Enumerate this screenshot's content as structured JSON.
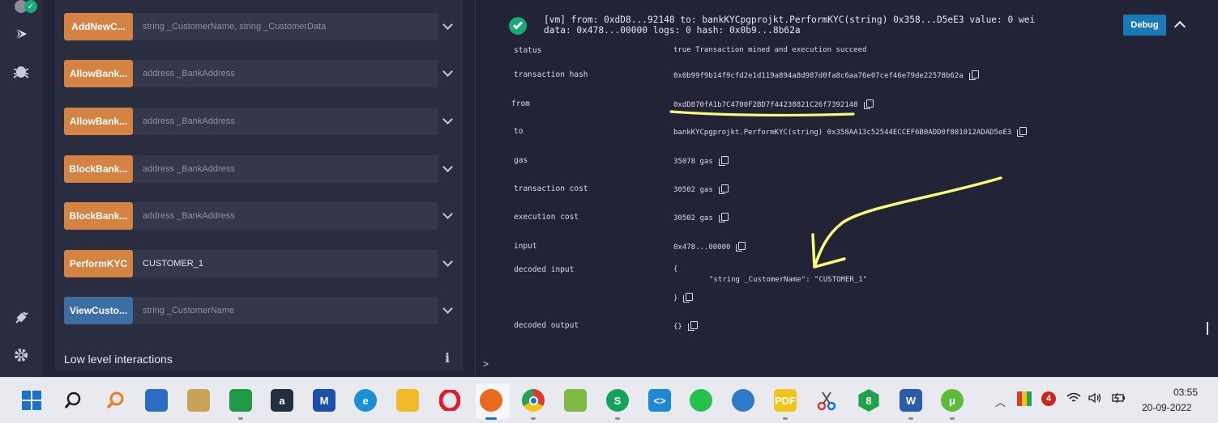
{
  "functions": [
    {
      "label": "AddNewC...",
      "field": "string _CustomerName, string _CustomerData",
      "filled": false,
      "color": "#d48343"
    },
    {
      "label": "AllowBank...",
      "field": "address _BankAddress",
      "filled": false,
      "color": "#d48343"
    },
    {
      "label": "AllowBank...",
      "field": "address _BankAddress",
      "filled": false,
      "color": "#d48343"
    },
    {
      "label": "BlockBank...",
      "field": "address _BankAddress",
      "filled": false,
      "color": "#d48343"
    },
    {
      "label": "BlockBank...",
      "field": "address _BankAddress",
      "filled": false,
      "color": "#d48343"
    },
    {
      "label": "PerformKYC",
      "field": "CUSTOMER_1",
      "filled": true,
      "color": "#d48343"
    },
    {
      "label": "ViewCusto...",
      "field": "string _CustomerName",
      "filled": false,
      "color": "#3a6ea5"
    }
  ],
  "panel": {
    "low_level": "Low level interactions",
    "info": "i"
  },
  "tx": {
    "head_line1": "[vm]  from: 0xdD8...92148 to: bankKYCpgprojkt.PerformKYC(string) 0x358...D5eE3 value: 0 wei",
    "head_line2": "data: 0x478...00000 logs: 0 hash: 0x0b9...8b62a",
    "debug": "Debug",
    "rows": [
      {
        "label": "status",
        "value": "true Transaction mined and execution succeed",
        "copy": false
      },
      {
        "label": "transaction hash",
        "value": "0x0b99f9b14f9cfd2e1d119a894a8d987d0fa8c6aa76e07cef46e79de22578b62a",
        "copy": true
      },
      {
        "label": "from",
        "value": "0xdD870fA1b7C4700F2BD7f44238821C26f7392148",
        "copy": true
      },
      {
        "label": "to",
        "value": "bankKYCpgprojkt.PerformKYC(string) 0x358AA13c52544ECCEF6B0ADD0f801012ADAD5eE3",
        "copy": true
      },
      {
        "label": "gas",
        "value": "35078 gas",
        "copy": true
      },
      {
        "label": "transaction cost",
        "value": "30502 gas",
        "copy": true
      },
      {
        "label": "execution cost",
        "value": "30502 gas",
        "copy": true
      },
      {
        "label": "input",
        "value": "0x478...00000",
        "copy": true
      },
      {
        "label": "decoded input",
        "value": "{",
        "copy": false
      },
      {
        "label": "",
        "value": "\"string _CustomerName\": \"CUSTOMER_1\"",
        "copy": false
      },
      {
        "label": "",
        "value": "}",
        "copy": true
      },
      {
        "label": "decoded output",
        "value": "{}",
        "copy": true
      }
    ],
    "prompt": ">"
  },
  "taskbar": {
    "time": "03:55",
    "date": "20-09-2022",
    "notification_count": "4",
    "apps": [
      {
        "name": "windows-start-icon",
        "color": "#1a73c7",
        "glyph": ""
      },
      {
        "name": "search-icon",
        "color": "#e9eaf0",
        "glyph": ""
      },
      {
        "name": "search-orange-icon",
        "color": "#e9eaf0",
        "glyph": ""
      },
      {
        "name": "microsoft-store-icon",
        "color": "#2b6cc4",
        "glyph": ""
      },
      {
        "name": "package-icon",
        "color": "#c9a25a",
        "glyph": ""
      },
      {
        "name": "green-app-icon",
        "color": "#1e9a46",
        "glyph": ""
      },
      {
        "name": "amazon-icon",
        "color": "#232f3e",
        "glyph": "a"
      },
      {
        "name": "mathpix-icon",
        "color": "#1c4fa8",
        "glyph": "M"
      },
      {
        "name": "edge-icon",
        "color": "#1a8fd6",
        "glyph": "e"
      },
      {
        "name": "file-explorer-icon",
        "color": "#f2b92b",
        "glyph": ""
      },
      {
        "name": "opera-icon",
        "color": "#e9eaf0",
        "glyph": "O"
      },
      {
        "name": "firefox-icon",
        "color": "#ea6a1d",
        "glyph": ""
      },
      {
        "name": "chrome-icon",
        "color": "#2aa156",
        "glyph": ""
      },
      {
        "name": "notepad-plus-icon",
        "color": "#7fb843",
        "glyph": ""
      },
      {
        "name": "green-s-icon",
        "color": "#17a25a",
        "glyph": "S"
      },
      {
        "name": "vscode-icon",
        "color": "#1e88d6",
        "glyph": "<>"
      },
      {
        "name": "whatsapp-icon",
        "color": "#25c14f",
        "glyph": ""
      },
      {
        "name": "globe-download-icon",
        "color": "#2d7ac9",
        "glyph": ""
      },
      {
        "name": "pdf-icon",
        "color": "#f0c419",
        "glyph": "PDF"
      },
      {
        "name": "snipping-tool-icon",
        "color": "#e9eaf0",
        "glyph": ""
      },
      {
        "name": "green-8-icon",
        "color": "#1fa149",
        "glyph": "8"
      },
      {
        "name": "word-icon",
        "color": "#2b5cab",
        "glyph": "W"
      },
      {
        "name": "utorrent-icon",
        "color": "#5cbc3a",
        "glyph": "μ"
      }
    ]
  },
  "colors": {
    "background": "#222336",
    "panel": "#2a2c3f",
    "accent_orange": "#d48343",
    "accent_blue": "#3a6ea5",
    "success": "#19a974",
    "annotation": "#fafa7a"
  }
}
